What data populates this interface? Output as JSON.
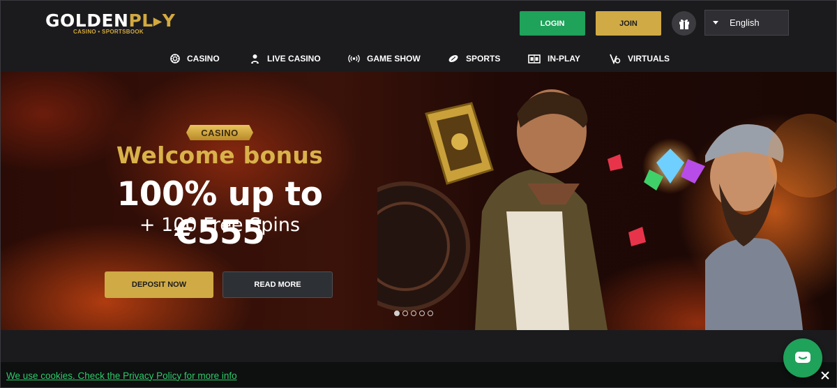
{
  "header": {
    "logo": {
      "text_a": "GOLDEN",
      "text_b": "PL",
      "text_c": "Y",
      "subtitle": "CASINO • SPORTSBOOK"
    },
    "login_label": "LOGIN",
    "join_label": "JOIN",
    "language": "English",
    "colors": {
      "login": "#1fa25a",
      "join": "#d0aa45",
      "accent": "#d9b24a"
    }
  },
  "nav": {
    "items": [
      {
        "label": "CASINO",
        "icon": "casino-chip-icon"
      },
      {
        "label": "LIVE CASINO",
        "icon": "dealer-icon"
      },
      {
        "label": "GAME SHOW",
        "icon": "broadcast-icon"
      },
      {
        "label": "SPORTS",
        "icon": "rugby-ball-icon"
      },
      {
        "label": "IN-PLAY",
        "icon": "scoreboard-icon"
      },
      {
        "label": "VIRTUALS",
        "icon": "virtual-sports-icon"
      }
    ]
  },
  "hero": {
    "tag": "CASINO",
    "title": "Welcome bonus",
    "amount": "100% up to €555",
    "extra": "+ 100 Free Spins",
    "deposit_label": "DEPOSIT NOW",
    "readmore_label": "READ MORE",
    "slides": {
      "count": 5,
      "active": 1
    }
  },
  "cookie": {
    "text": "We use cookies. Check the Privacy Policy for more info"
  }
}
